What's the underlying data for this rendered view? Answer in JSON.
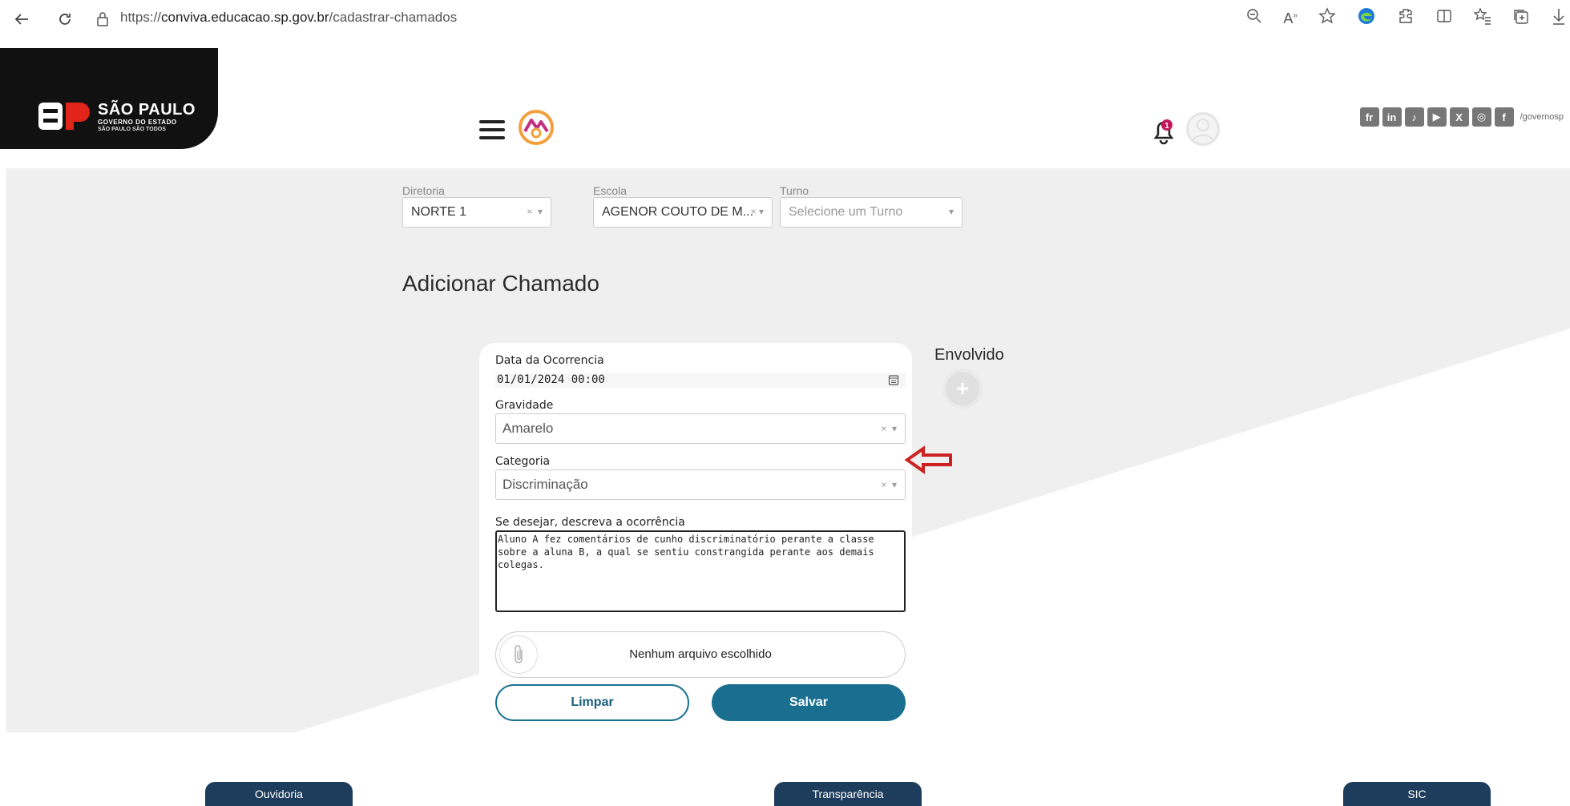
{
  "browser": {
    "url_prefix": "https://",
    "url_domain": "conviva.educacao.sp.gov.br",
    "url_path": "/cadastrar-chamados",
    "back_icon": "back-arrow-icon",
    "reload_icon": "reload-icon"
  },
  "header": {
    "brand_line1": "SÃO PAULO",
    "brand_line2": "GOVERNO DO ESTADO",
    "brand_line3": "SÃO PAULO SÃO TODOS",
    "social_handle": "/governosp",
    "social_icons": [
      "fr",
      "in",
      "tiktok",
      "youtube",
      "x",
      "instagram",
      "facebook"
    ],
    "notification_count": "1"
  },
  "filters": {
    "diretoria_label": "Diretoria",
    "diretoria_value": "NORTE 1",
    "escola_label": "Escola",
    "escola_value": "AGENOR COUTO DE M...",
    "turno_label": "Turno",
    "turno_placeholder": "Selecione um Turno"
  },
  "page": {
    "title": "Adicionar Chamado"
  },
  "form": {
    "date_label": "Data da Ocorrencia",
    "date_value": "01/01/2024 00:00",
    "gravidade_label": "Gravidade",
    "gravidade_value": "Amarelo",
    "categoria_label": "Categoria",
    "categoria_value": "Discriminação",
    "descricao_label": "Se desejar, descreva a ocorrência",
    "descricao_value": "Aluno A fez comentários de cunho discriminatório perante a classe sobre a aluna B, a qual se sentiu constrangida perante aos demais colegas.",
    "file_text": "Nenhum arquivo escolhido",
    "clear_label": "Limpar",
    "save_label": "Salvar"
  },
  "envolvido": {
    "title": "Envolvido",
    "add_symbol": "+"
  },
  "footer": {
    "ouvidoria": "Ouvidoria",
    "transparencia": "Transparência",
    "sic": "SIC"
  },
  "colors": {
    "primary": "#1a6f91",
    "footer": "#1e3d5c",
    "arrow": "#cc2222",
    "background": "#efefef"
  }
}
